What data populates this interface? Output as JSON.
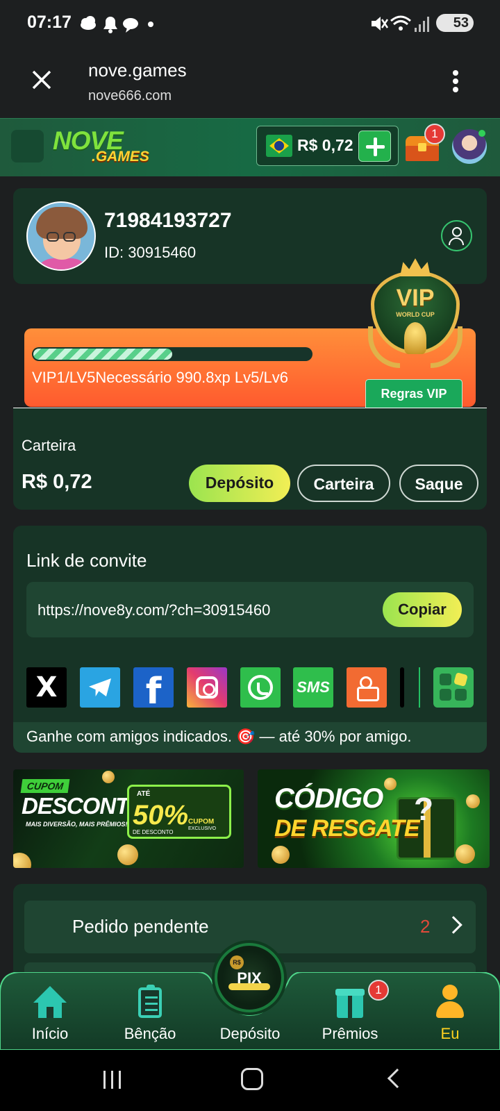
{
  "status_bar": {
    "time": "07:17",
    "battery": "53",
    "icons": [
      "cloud-icon",
      "bell-icon",
      "chat-icon",
      "dot-icon",
      "mute-icon",
      "wifi-icon",
      "signal-icon",
      "battery-icon"
    ]
  },
  "browser": {
    "title": "nove.games",
    "url": "nove666.com",
    "icons": [
      "close-icon",
      "more-vert-icon"
    ]
  },
  "header": {
    "logo_top": "NOVE",
    "logo_bottom": ".GAMES",
    "balance": "R$ 0,72",
    "chest_badge": "1",
    "icons": [
      "menu-icon",
      "brazil-flag-icon",
      "plus-icon",
      "treasure-chest-icon",
      "profile-avatar-icon"
    ]
  },
  "user": {
    "username": "71984193727",
    "id_text": "ID: 30915460"
  },
  "vip": {
    "badge_title": "VIP",
    "badge_subtitle": "WORLD CUP",
    "progress_fraction": 0.5,
    "progress_text": "VIP1/LV5Necessário 990.8xp Lv5/Lv6",
    "rules_label": "Regras VIP"
  },
  "wallet": {
    "label": "Carteira",
    "amount": "R$ 0,72",
    "buttons": {
      "deposit": "Depósito",
      "wallet": "Carteira",
      "withdraw": "Saque"
    }
  },
  "invite": {
    "title": "Link de convite",
    "link": "https://nove8y.com/?ch=30915460",
    "copy_label": "Copiar",
    "social": {
      "x": "X",
      "facebook": "f",
      "sms": "SMS"
    },
    "footer": "Ganhe com amigos indicados. 🎯 — até 30% por amigo."
  },
  "banners": {
    "coupon": {
      "tag": "CUPOM",
      "title": "DESCONTO",
      "subtitle": "MAIS DIVERSÃO, MAIS PRÊMIOS!",
      "up_to": "ATÉ",
      "percent": "50%",
      "desc": "DE DESCONTO",
      "cupom": "CUPOM",
      "exclusive": "EXCLUSIVO"
    },
    "code": {
      "line1": "CÓDIGO",
      "line2": "DE RESGATE"
    }
  },
  "orders": {
    "pending_label": "Pedido pendente",
    "pending_count": "2"
  },
  "bottom_nav": {
    "items": [
      {
        "label": "Início",
        "icon": "home-icon"
      },
      {
        "label": "Bênção",
        "icon": "clipboard-icon"
      },
      {
        "label": "Depósito",
        "icon": "pix-icon"
      },
      {
        "label": "Prêmios",
        "icon": "gift-icon"
      },
      {
        "label": "Eu",
        "icon": "person-icon"
      }
    ],
    "pix_label": "PIX",
    "pix_coin": "R$",
    "premios_badge": "1",
    "active_color": "#ffd21f"
  },
  "colors": {
    "brand_green": "#23b14c",
    "card_bg": "#173426",
    "vip_orange": "#ff6a32",
    "accent_yellow": "#f2ee55"
  }
}
